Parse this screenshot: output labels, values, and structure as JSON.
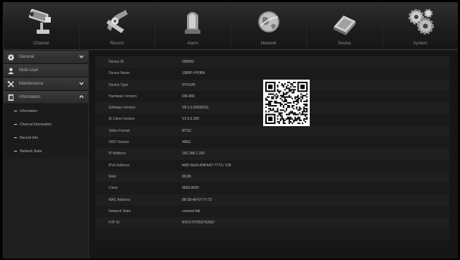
{
  "tabs": [
    {
      "label": "Channel",
      "icon": "camera-icon"
    },
    {
      "label": "Record",
      "icon": "film-reel-icon"
    },
    {
      "label": "Alarm",
      "icon": "alarm-light-icon"
    },
    {
      "label": "Network",
      "icon": "globe-icon"
    },
    {
      "label": "Device",
      "icon": "hard-drive-icon"
    },
    {
      "label": "System",
      "icon": "gears-icon"
    }
  ],
  "sidebar": {
    "items": [
      {
        "label": "General",
        "icon": "gear-icon",
        "expanded": false
      },
      {
        "label": "Multi-User",
        "icon": "user-icon"
      },
      {
        "label": "Maintenance",
        "icon": "tools-icon",
        "expanded": false
      },
      {
        "label": "Information",
        "icon": "info-book-icon",
        "expanded": true
      }
    ],
    "sub_items": [
      "Information",
      "Channel Information",
      "Record Info",
      "Network State"
    ]
  },
  "info": {
    "rows": [
      {
        "key": "Device ID",
        "value": "000000"
      },
      {
        "key": "Device Name",
        "value": "1080P-HY08N"
      },
      {
        "key": "Device Type",
        "value": "HY-DVR"
      },
      {
        "key": "Hardware Version",
        "value": "DM-365"
      },
      {
        "key": "Software Version",
        "value": "V8.1.0-20200311"
      },
      {
        "key": "IE Client Version",
        "value": "V2.0.0.209"
      },
      {
        "key": "Video Format",
        "value": "NTSC"
      },
      {
        "key": "HDD Volume",
        "value": "466G"
      },
      {
        "key": "IP Address",
        "value": "192.168.1.100"
      },
      {
        "key": "IPv6 Address",
        "value": "fe80::8a1b:40ff:fe67:7773 / 128"
      },
      {
        "key": "Web",
        "value": "80,80"
      },
      {
        "key": "Client",
        "value": "9000,9000"
      },
      {
        "key": "MAC Address",
        "value": "88-1B-40-67-77-73"
      },
      {
        "key": "Network State",
        "value": "connect fail"
      },
      {
        "key": "P2P ID",
        "value": "RSV1707050752567"
      },
      {
        "key": "",
        "value": ""
      }
    ]
  },
  "colors": {
    "background": "#191919",
    "menu": "#2b2b2b",
    "text": "#bdbdbd"
  }
}
